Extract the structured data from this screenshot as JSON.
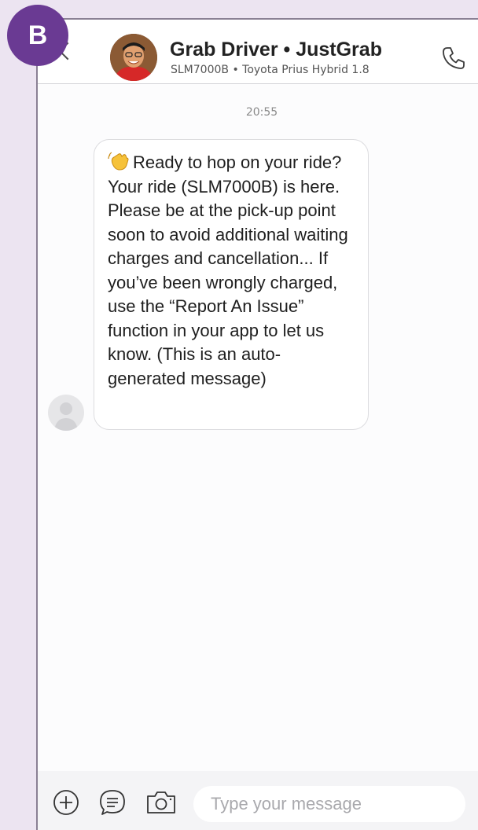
{
  "badge": {
    "letter": "B"
  },
  "header": {
    "title": "Grab Driver • JustGrab",
    "subtitle": "SLM7000B • Toyota Prius Hybrid 1.8"
  },
  "chat": {
    "timestamp": "20:55",
    "message": {
      "emoji_icon": "waving-hand-icon",
      "text": "Ready to hop on your ride? Your ride (SLM7000B) is here. Please be at the pick-up point soon to avoid additional waiting charges and cancellation... If you’ve been wrongly charged, use the “Report An Issue” function in your app to let us know. (This is an auto-generated message)"
    }
  },
  "composer": {
    "placeholder": "Type your message",
    "icons": [
      "add-icon",
      "quick-reply-icon",
      "camera-icon"
    ]
  },
  "colors": {
    "badge": "#6a3a93",
    "background": "#ece4f1",
    "chat_background": "#fcfcfd"
  }
}
